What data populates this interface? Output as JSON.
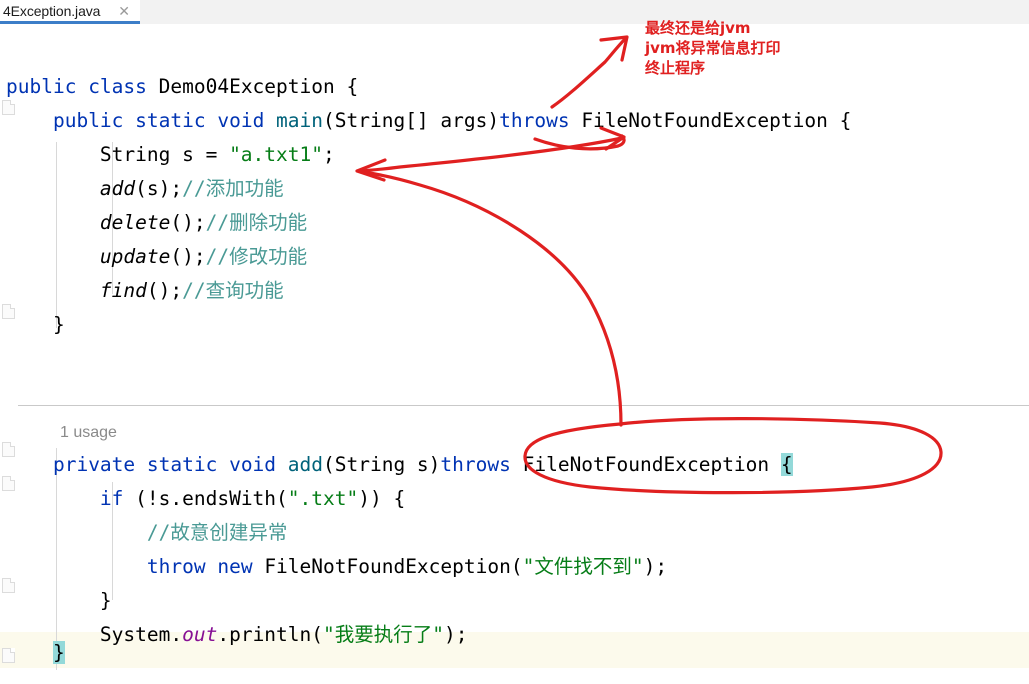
{
  "window": {
    "app": "java-code-editor",
    "background": "#ffffff"
  },
  "tabbar": {
    "tabs": [
      {
        "label": "4Exception.java",
        "close_icon": "close-icon",
        "active": true,
        "accent": "#3c7ec8"
      }
    ]
  },
  "editor": {
    "language": "java",
    "gutter": {
      "fold_markers": 5
    },
    "usage_hint": "1 usage",
    "caret_line_highlight": "#fcfaec",
    "bracket_highlight": "#93d9d9",
    "lines": [
      {
        "id": "line-class-decl",
        "indent": 0,
        "tokens": [
          {
            "t": "public ",
            "c": "kw"
          },
          {
            "t": "class ",
            "c": "kw"
          },
          {
            "t": "Demo04Exception {",
            "c": "plain"
          }
        ]
      },
      {
        "id": "line-main-decl",
        "indent": 1,
        "tokens": [
          {
            "t": "public ",
            "c": "kw"
          },
          {
            "t": "static ",
            "c": "kw"
          },
          {
            "t": "void ",
            "c": "kw"
          },
          {
            "t": "main",
            "c": "mth"
          },
          {
            "t": "(String[] args)",
            "c": "plain"
          },
          {
            "t": "throws ",
            "c": "kw"
          },
          {
            "t": "FileNotFoundException {",
            "c": "plain"
          }
        ]
      },
      {
        "id": "line-string-s",
        "indent": 2,
        "tokens": [
          {
            "t": "String s = ",
            "c": "plain"
          },
          {
            "t": "\"a.txt1\"",
            "c": "str"
          },
          {
            "t": ";",
            "c": "plain"
          }
        ]
      },
      {
        "id": "line-add-call",
        "indent": 2,
        "tokens": [
          {
            "t": "add",
            "c": "itl"
          },
          {
            "t": "(s);",
            "c": "plain"
          },
          {
            "t": "//添加功能",
            "c": "cmt-cn"
          }
        ]
      },
      {
        "id": "line-delete-call",
        "indent": 2,
        "tokens": [
          {
            "t": "delete",
            "c": "itl"
          },
          {
            "t": "();",
            "c": "plain"
          },
          {
            "t": "//删除功能",
            "c": "cmt-cn"
          }
        ]
      },
      {
        "id": "line-update-call",
        "indent": 2,
        "tokens": [
          {
            "t": "update",
            "c": "itl"
          },
          {
            "t": "();",
            "c": "plain"
          },
          {
            "t": "//修改功能",
            "c": "cmt-cn"
          }
        ]
      },
      {
        "id": "line-find-call",
        "indent": 2,
        "tokens": [
          {
            "t": "find",
            "c": "itl"
          },
          {
            "t": "();",
            "c": "plain"
          },
          {
            "t": "//查询功能",
            "c": "cmt-cn"
          }
        ]
      },
      {
        "id": "line-main-close",
        "indent": 1,
        "tokens": [
          {
            "t": "}",
            "c": "plain"
          }
        ]
      }
    ],
    "lines_lower": [
      {
        "id": "line-add-decl",
        "indent": 1,
        "tokens": [
          {
            "t": "private ",
            "c": "kw"
          },
          {
            "t": "static ",
            "c": "kw"
          },
          {
            "t": "void ",
            "c": "kw"
          },
          {
            "t": "add",
            "c": "mth"
          },
          {
            "t": "(String s)",
            "c": "plain"
          },
          {
            "t": "throws ",
            "c": "kw"
          },
          {
            "t": "FileNotFoundException ",
            "c": "plain"
          },
          {
            "t": "{",
            "c": "brkt-hl"
          }
        ]
      },
      {
        "id": "line-if-endswith",
        "indent": 2,
        "tokens": [
          {
            "t": "if ",
            "c": "kw"
          },
          {
            "t": "(!s.endsWith(",
            "c": "plain"
          },
          {
            "t": "\".txt\"",
            "c": "str"
          },
          {
            "t": ")) {",
            "c": "plain"
          }
        ]
      },
      {
        "id": "line-comment-create",
        "indent": 3,
        "tokens": [
          {
            "t": "//故意创建异常",
            "c": "cmt-cn"
          }
        ]
      },
      {
        "id": "line-throw-new",
        "indent": 3,
        "tokens": [
          {
            "t": "throw ",
            "c": "kw"
          },
          {
            "t": "new ",
            "c": "kw"
          },
          {
            "t": "FileNotFoundException(",
            "c": "plain"
          },
          {
            "t": "\"文件找不到\"",
            "c": "str"
          },
          {
            "t": ");",
            "c": "plain"
          }
        ]
      },
      {
        "id": "line-if-close",
        "indent": 2,
        "tokens": [
          {
            "t": "}",
            "c": "plain"
          }
        ]
      },
      {
        "id": "line-println",
        "indent": 2,
        "tokens": [
          {
            "t": "System.",
            "c": "plain"
          },
          {
            "t": "out",
            "c": "fld"
          },
          {
            "t": ".println(",
            "c": "plain"
          },
          {
            "t": "\"我要执行了\"",
            "c": "str"
          },
          {
            "t": ");",
            "c": "plain"
          }
        ]
      }
    ],
    "caret_line": {
      "id": "line-add-close",
      "indent": 1,
      "tokens": [
        {
          "t": "}",
          "c": "brkt-hl"
        }
      ]
    }
  },
  "annotations": {
    "ink_color": "#e02020",
    "note_jvm": {
      "name": "handwritten-note-jvm",
      "lines": [
        "最终还是给jvm",
        "jvm将异常信息打印",
        "终止程序"
      ],
      "text": "最终还是给jvm\njvm将异常信息打印\n终止程序"
    },
    "marks": [
      {
        "name": "arrow-to-main-throws",
        "shape": "arrow"
      },
      {
        "name": "arrow-to-add-call",
        "shape": "arrow"
      },
      {
        "name": "arrow-from-add-throws-to-add-call",
        "shape": "curved-arrow"
      },
      {
        "name": "ellipse-around-add-throws",
        "shape": "ellipse"
      }
    ]
  }
}
